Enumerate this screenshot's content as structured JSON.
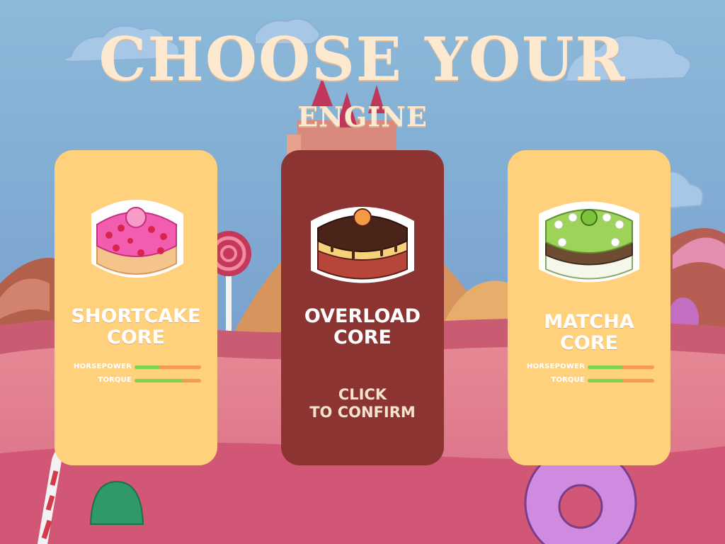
{
  "screen": {
    "title_line1": "CHOOSE YOUR",
    "title_line2": "ENGINE"
  },
  "colors": {
    "title": "#fde9cf",
    "card_light": "#ffd17d",
    "card_selected": "#8c3432",
    "stat_fill": "#7ed44f",
    "stat_track": "#f49a53"
  },
  "cards": [
    {
      "id": "shortcake",
      "name_line1": "SHORTCAKE",
      "name_line2": "CORE",
      "icon": "strawberry-shortcake-icon",
      "selected": false,
      "stats": [
        {
          "label": "HORSEPOWER",
          "value": 0.38
        },
        {
          "label": "TORQUE",
          "value": 0.72
        }
      ]
    },
    {
      "id": "overload",
      "name_line1": "OVERLOAD",
      "name_line2": "CORE",
      "icon": "chocolate-layer-cake-icon",
      "selected": true,
      "confirm_line1": "CLICK",
      "confirm_line2": "TO CONFIRM"
    },
    {
      "id": "matcha",
      "name_line1": "MATCHA",
      "name_line2": "CORE",
      "icon": "matcha-cake-icon",
      "selected": false,
      "stats": [
        {
          "label": "HORSEPOWER",
          "value": 0.52
        },
        {
          "label": "TORQUE",
          "value": 0.52
        }
      ]
    }
  ]
}
